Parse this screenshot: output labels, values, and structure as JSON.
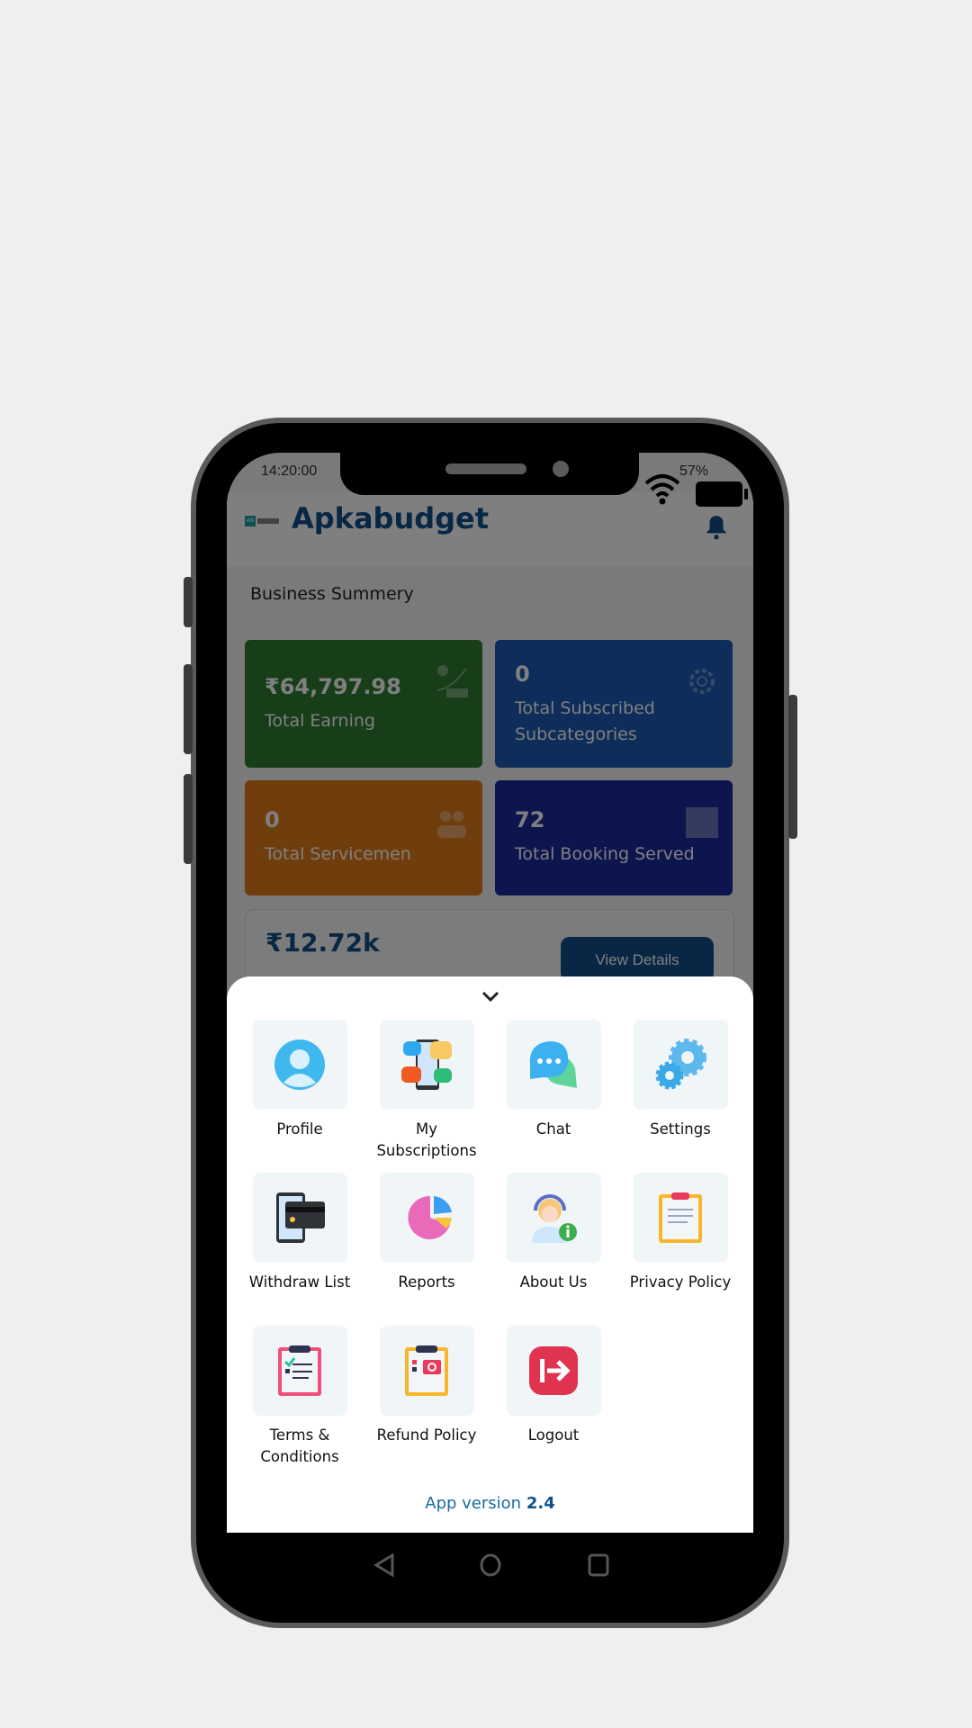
{
  "status_bar": {
    "time": "14:20:00",
    "battery": "57%"
  },
  "app_bar": {
    "title": "Apkabudget",
    "logo_text": "AB"
  },
  "summary": {
    "title": "Business Summery",
    "cards": [
      {
        "value": "₹64,797.98",
        "label": "Total Earning",
        "color": "#2e7d32",
        "icon": "earning-chart-icon"
      },
      {
        "value": "0",
        "label": "Total Subscribed Subcategories",
        "color": "#1f5bb5",
        "icon": "gear-icon"
      },
      {
        "value": "0",
        "label": "Total Servicemen",
        "color": "#e07b1a",
        "icon": "team-icon"
      },
      {
        "value": "72",
        "label": "Total Booking Served",
        "color": "#1a2a9c",
        "icon": "calendar-icon"
      }
    ],
    "earnings": {
      "value": "₹12.72k",
      "button": "View Details"
    }
  },
  "sheet": {
    "items": [
      {
        "label": "Profile",
        "icon": "profile-icon"
      },
      {
        "label": "My Subscriptions",
        "icon": "subscriptions-icon"
      },
      {
        "label": "Chat",
        "icon": "chat-icon"
      },
      {
        "label": "Settings",
        "icon": "settings-icon"
      },
      {
        "label": "Withdraw List",
        "icon": "withdraw-icon"
      },
      {
        "label": "Reports",
        "icon": "reports-icon"
      },
      {
        "label": "About Us",
        "icon": "about-icon"
      },
      {
        "label": "Privacy Policy",
        "icon": "privacy-icon"
      },
      {
        "label": "Terms & Conditions",
        "icon": "terms-icon"
      },
      {
        "label": "Refund Policy",
        "icon": "refund-icon"
      },
      {
        "label": "Logout",
        "icon": "logout-icon"
      }
    ],
    "version_label": "App version",
    "version_number": "2.4"
  }
}
